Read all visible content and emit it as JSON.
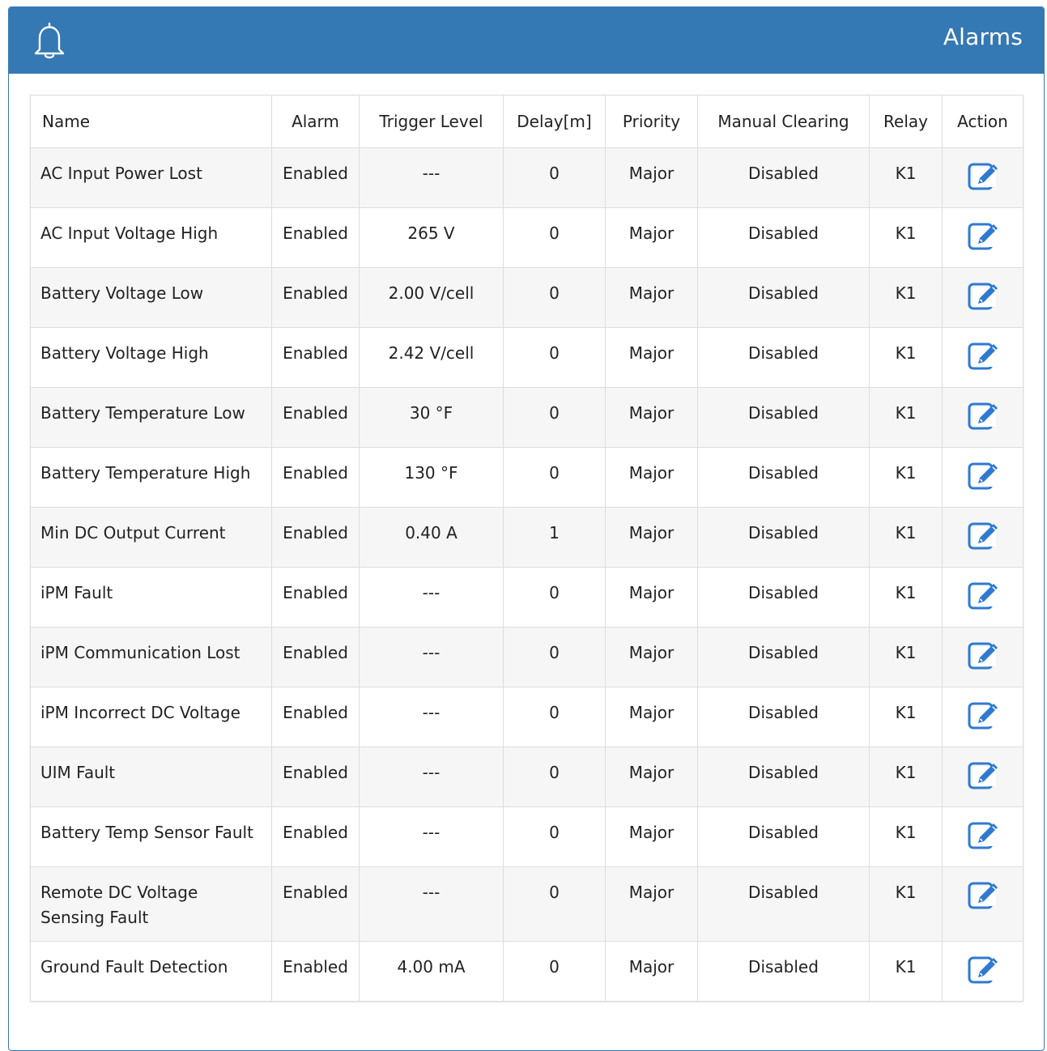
{
  "header": {
    "title": "Alarms",
    "icon": "bell-icon",
    "color": "#3478b4"
  },
  "table": {
    "columns": [
      "Name",
      "Alarm",
      "Trigger Level",
      "Delay[m]",
      "Priority",
      "Manual Clearing",
      "Relay",
      "Action"
    ],
    "rows": [
      {
        "name": "AC Input Power Lost",
        "alarm": "Enabled",
        "trigger": "---",
        "delay": "0",
        "priority": "Major",
        "manual_clearing": "Disabled",
        "relay": "K1"
      },
      {
        "name": "AC Input Voltage High",
        "alarm": "Enabled",
        "trigger": "265 V",
        "delay": "0",
        "priority": "Major",
        "manual_clearing": "Disabled",
        "relay": "K1"
      },
      {
        "name": "Battery Voltage Low",
        "alarm": "Enabled",
        "trigger": "2.00 V/cell",
        "delay": "0",
        "priority": "Major",
        "manual_clearing": "Disabled",
        "relay": "K1"
      },
      {
        "name": "Battery Voltage High",
        "alarm": "Enabled",
        "trigger": "2.42 V/cell",
        "delay": "0",
        "priority": "Major",
        "manual_clearing": "Disabled",
        "relay": "K1"
      },
      {
        "name": "Battery Temperature Low",
        "alarm": "Enabled",
        "trigger": "30 °F",
        "delay": "0",
        "priority": "Major",
        "manual_clearing": "Disabled",
        "relay": "K1"
      },
      {
        "name": "Battery Temperature High",
        "alarm": "Enabled",
        "trigger": "130 °F",
        "delay": "0",
        "priority": "Major",
        "manual_clearing": "Disabled",
        "relay": "K1"
      },
      {
        "name": "Min DC Output Current",
        "alarm": "Enabled",
        "trigger": "0.40 A",
        "delay": "1",
        "priority": "Major",
        "manual_clearing": "Disabled",
        "relay": "K1"
      },
      {
        "name": "iPM Fault",
        "alarm": "Enabled",
        "trigger": "---",
        "delay": "0",
        "priority": "Major",
        "manual_clearing": "Disabled",
        "relay": "K1"
      },
      {
        "name": "iPM Communication Lost",
        "alarm": "Enabled",
        "trigger": "---",
        "delay": "0",
        "priority": "Major",
        "manual_clearing": "Disabled",
        "relay": "K1"
      },
      {
        "name": "iPM Incorrect DC Voltage",
        "alarm": "Enabled",
        "trigger": "---",
        "delay": "0",
        "priority": "Major",
        "manual_clearing": "Disabled",
        "relay": "K1"
      },
      {
        "name": "UIM Fault",
        "alarm": "Enabled",
        "trigger": "---",
        "delay": "0",
        "priority": "Major",
        "manual_clearing": "Disabled",
        "relay": "K1"
      },
      {
        "name": "Battery Temp Sensor Fault",
        "alarm": "Enabled",
        "trigger": "---",
        "delay": "0",
        "priority": "Major",
        "manual_clearing": "Disabled",
        "relay": "K1"
      },
      {
        "name": "Remote DC Voltage Sensing Fault",
        "alarm": "Enabled",
        "trigger": "---",
        "delay": "0",
        "priority": "Major",
        "manual_clearing": "Disabled",
        "relay": "K1"
      },
      {
        "name": "Ground Fault Detection",
        "alarm": "Enabled",
        "trigger": "4.00 mA",
        "delay": "0",
        "priority": "Major",
        "manual_clearing": "Disabled",
        "relay": "K1"
      }
    ],
    "action_icon": "edit-icon",
    "action_icon_color": "#2f7ad0"
  }
}
